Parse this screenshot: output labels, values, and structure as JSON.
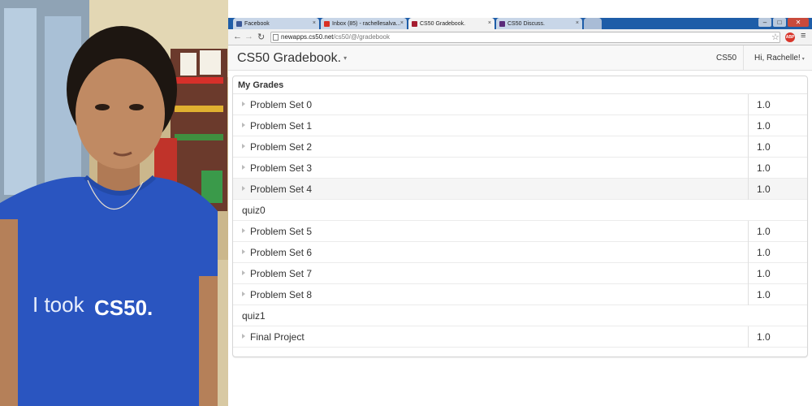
{
  "photo": {
    "shirt_text_1": "I took",
    "shirt_text_2": "CS50.",
    "colors": {
      "shirt": "#2a55c0",
      "background": "#c9b48a"
    }
  },
  "browser": {
    "tabs": [
      {
        "label": "Facebook",
        "favicon": "facebook-icon",
        "color": "#3b5998",
        "active": false
      },
      {
        "label": "Inbox (85) - rachellesalva...",
        "favicon": "gmail-icon",
        "color": "#d93025",
        "active": false
      },
      {
        "label": "CS50 Gradebook.",
        "favicon": "harvard-shield-icon",
        "color": "#a51c30",
        "active": true
      },
      {
        "label": "CS50 Discuss.",
        "favicon": "harvard-shield-icon",
        "color": "#5a2a7a",
        "active": false
      }
    ],
    "tab_close_glyph": "×",
    "url_host": "newapps.cs50.net",
    "url_path": "/cs50/@/gradebook",
    "abp_label": "ABP"
  },
  "app": {
    "brand": "CS50 Gradebook.",
    "course_link": "CS50",
    "user_menu": "Hi, Rachelle!"
  },
  "grades": {
    "heading": "My Grades",
    "psets_a": [
      {
        "name": "Problem Set 0",
        "score": "1.0"
      },
      {
        "name": "Problem Set 1",
        "score": "1.0"
      },
      {
        "name": "Problem Set 2",
        "score": "1.0"
      },
      {
        "name": "Problem Set 3",
        "score": "1.0"
      },
      {
        "name": "Problem Set 4",
        "score": "1.0"
      }
    ],
    "group_1": "quiz0",
    "psets_b": [
      {
        "name": "Problem Set 5",
        "score": "1.0"
      },
      {
        "name": "Problem Set 6",
        "score": "1.0"
      },
      {
        "name": "Problem Set 7",
        "score": "1.0"
      },
      {
        "name": "Problem Set 8",
        "score": "1.0"
      }
    ],
    "group_2": "quiz1",
    "final": {
      "name": "Final Project",
      "score": "1.0"
    }
  }
}
